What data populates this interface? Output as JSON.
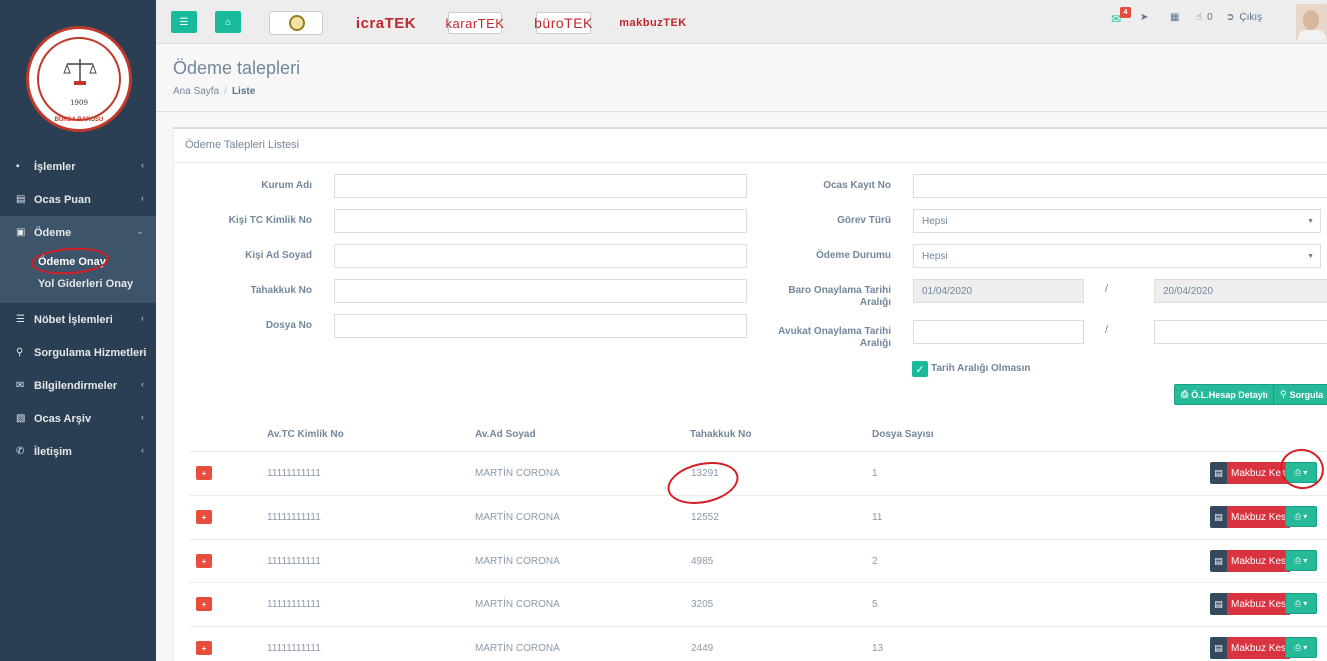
{
  "topnav": {
    "brands": [
      "icraTEK",
      "kararTEK",
      "büroTEK",
      "makbuzTEK"
    ],
    "badge_count": "4",
    "counter": "0",
    "logout": "Çıkış"
  },
  "logo": {
    "year": "1909",
    "ring_text": "BURSA BAROSU"
  },
  "sidebar": {
    "items": [
      {
        "label": "İşlemler",
        "icon": "folder-icon"
      },
      {
        "label": "Ocas Puan",
        "icon": "bar-chart-icon"
      },
      {
        "label": "Ödeme",
        "icon": "money-icon"
      },
      {
        "label": "Nöbet İşlemleri",
        "icon": "list-icon"
      },
      {
        "label": "Sorgulama Hizmetleri",
        "icon": "search-icon"
      },
      {
        "label": "Bilgilendirmeler",
        "icon": "envelope-icon"
      },
      {
        "label": "Ocas Arşiv",
        "icon": "archive-icon"
      },
      {
        "label": "İletişim",
        "icon": "phone-icon"
      }
    ],
    "submenu": [
      "Ödeme Onay",
      "Yol Giderleri Onay"
    ]
  },
  "page": {
    "title": "Ödeme talepleri",
    "breadcrumb_home": "Ana Sayfa",
    "breadcrumb_current": "Liste"
  },
  "panel": {
    "title": "Ödeme Talepleri Listesi"
  },
  "form": {
    "kurum_adi": "Kurum Adı",
    "kisi_tc": "Kişi TC Kimlik No",
    "kisi_ad": "Kişi Ad Soyad",
    "tahakkuk": "Tahakkuk No",
    "dosya": "Dosya No",
    "ocas_kayit": "Ocas Kayıt No",
    "gorev_turu": "Görev Türü",
    "gorev_turu_value": "Hepsi",
    "odeme_durumu": "Ödeme Durumu",
    "odeme_durumu_value": "Hepsi",
    "baro_tarih_1": "Baro Onaylama Tarihi",
    "baro_tarih_2": "Aralığı",
    "baro_start": "01/04/2020",
    "baro_end": "20/04/2020",
    "avukat_tarih_1": "Avukat Onaylama Tarihi",
    "avukat_tarih_2": "Aralığı",
    "slash": "/",
    "checkbox_label": "Tarih Aralığı Olmasın",
    "btn_hesap": "Ö.L.Hesap Detaylı",
    "btn_sorgula": "Sorgula"
  },
  "table": {
    "headers": [
      "Av.TC Kimlik No",
      "Av.Ad Soyad",
      "Tahakkuk No",
      "Dosya Sayısı"
    ],
    "rows": [
      {
        "tc": "11111111111",
        "ad": "MARTİN CORONA",
        "tahakkuk": "13291",
        "dosya": "1"
      },
      {
        "tc": "11111111111",
        "ad": "MARTİN CORONA",
        "tahakkuk": "12552",
        "dosya": "11"
      },
      {
        "tc": "11111111111",
        "ad": "MARTİN CORONA",
        "tahakkuk": "4985",
        "dosya": "2"
      },
      {
        "tc": "11111111111",
        "ad": "MARTİN CORONA",
        "tahakkuk": "3205",
        "dosya": "5"
      },
      {
        "tc": "11111111111",
        "ad": "MARTİN CORONA",
        "tahakkuk": "2449",
        "dosya": "13"
      }
    ],
    "makbuz_label": "Makbuz Kes",
    "plus_symbol": "+"
  }
}
